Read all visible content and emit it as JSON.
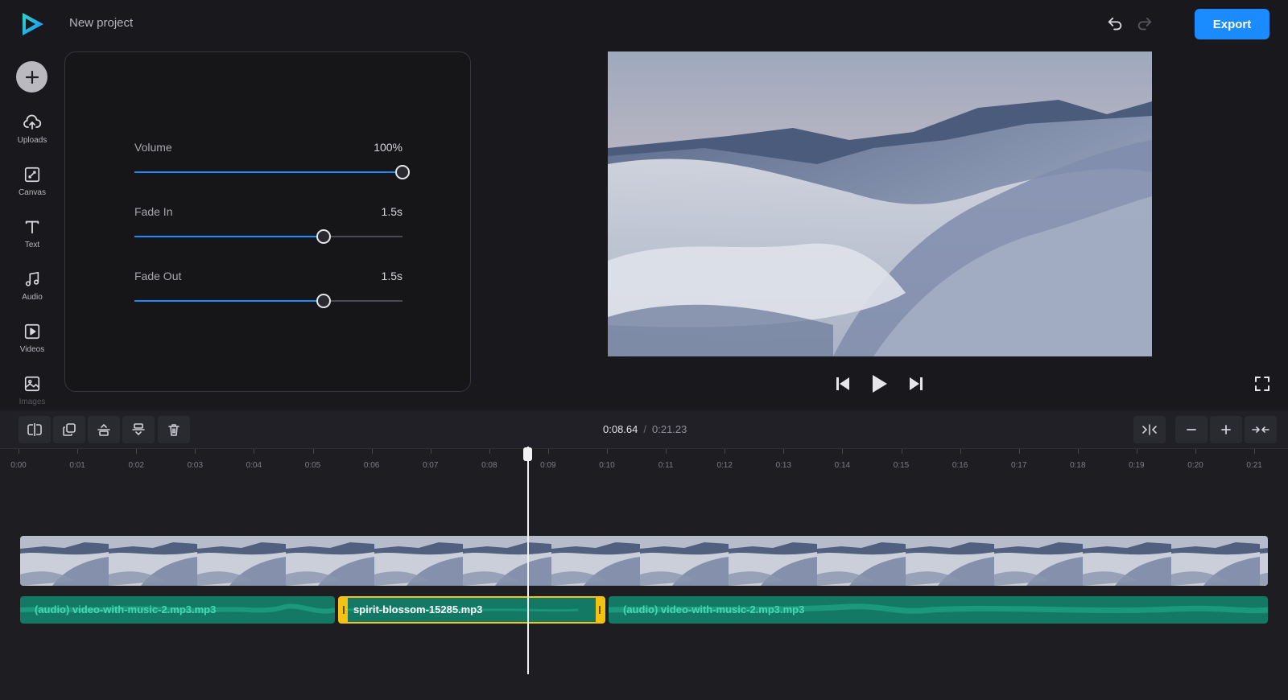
{
  "header": {
    "project_title": "New project",
    "export_label": "Export",
    "undo_icon": "undo-icon",
    "redo_icon": "redo-icon"
  },
  "sidebar": {
    "add_icon": "plus-icon",
    "items": [
      {
        "label": "Uploads",
        "icon": "upload-cloud-icon"
      },
      {
        "label": "Canvas",
        "icon": "canvas-resize-icon"
      },
      {
        "label": "Text",
        "icon": "text-t-icon"
      },
      {
        "label": "Audio",
        "icon": "music-note-icon"
      },
      {
        "label": "Videos",
        "icon": "video-play-icon"
      },
      {
        "label": "Images",
        "icon": "image-icon"
      }
    ]
  },
  "properties": {
    "volume": {
      "label": "Volume",
      "value": "100%",
      "fraction": 1.0
    },
    "fade_in": {
      "label": "Fade In",
      "value": "1.5s",
      "fraction": 0.705
    },
    "fade_out": {
      "label": "Fade Out",
      "value": "1.5s",
      "fraction": 0.705
    }
  },
  "player": {
    "prev_icon": "skip-back-icon",
    "play_icon": "play-icon",
    "next_icon": "skip-forward-icon",
    "fullscreen_icon": "fullscreen-icon"
  },
  "timeline": {
    "current_time": "0:08.64",
    "total_time": "0:21.23",
    "tools": [
      "split-icon",
      "duplicate-icon",
      "align-top-icon",
      "align-bottom-icon",
      "trash-icon"
    ],
    "zoom_tools": [
      "fit-icon",
      "zoom-out-icon",
      "zoom-in-icon",
      "collapse-icon"
    ],
    "ticks": [
      "0:00",
      "0:01",
      "0:02",
      "0:03",
      "0:04",
      "0:05",
      "0:06",
      "0:07",
      "0:08",
      "0:09",
      "0:10",
      "0:11",
      "0:12",
      "0:13",
      "0:14",
      "0:15",
      "0:16",
      "0:17",
      "0:18",
      "0:19",
      "0:20",
      "0:21"
    ],
    "audio_clips": [
      {
        "name": "(audio) video-with-music-2.mp3.mp3",
        "selected": false
      },
      {
        "name": "spirit-blossom-15285.mp3",
        "selected": true
      },
      {
        "name": "(audio) video-with-music-2.mp3.mp3",
        "selected": false
      }
    ]
  },
  "colors": {
    "accent": "#1a8cff",
    "selection": "#f4c211",
    "audio_clip": "#137864",
    "audio_text": "#47d7b1"
  }
}
